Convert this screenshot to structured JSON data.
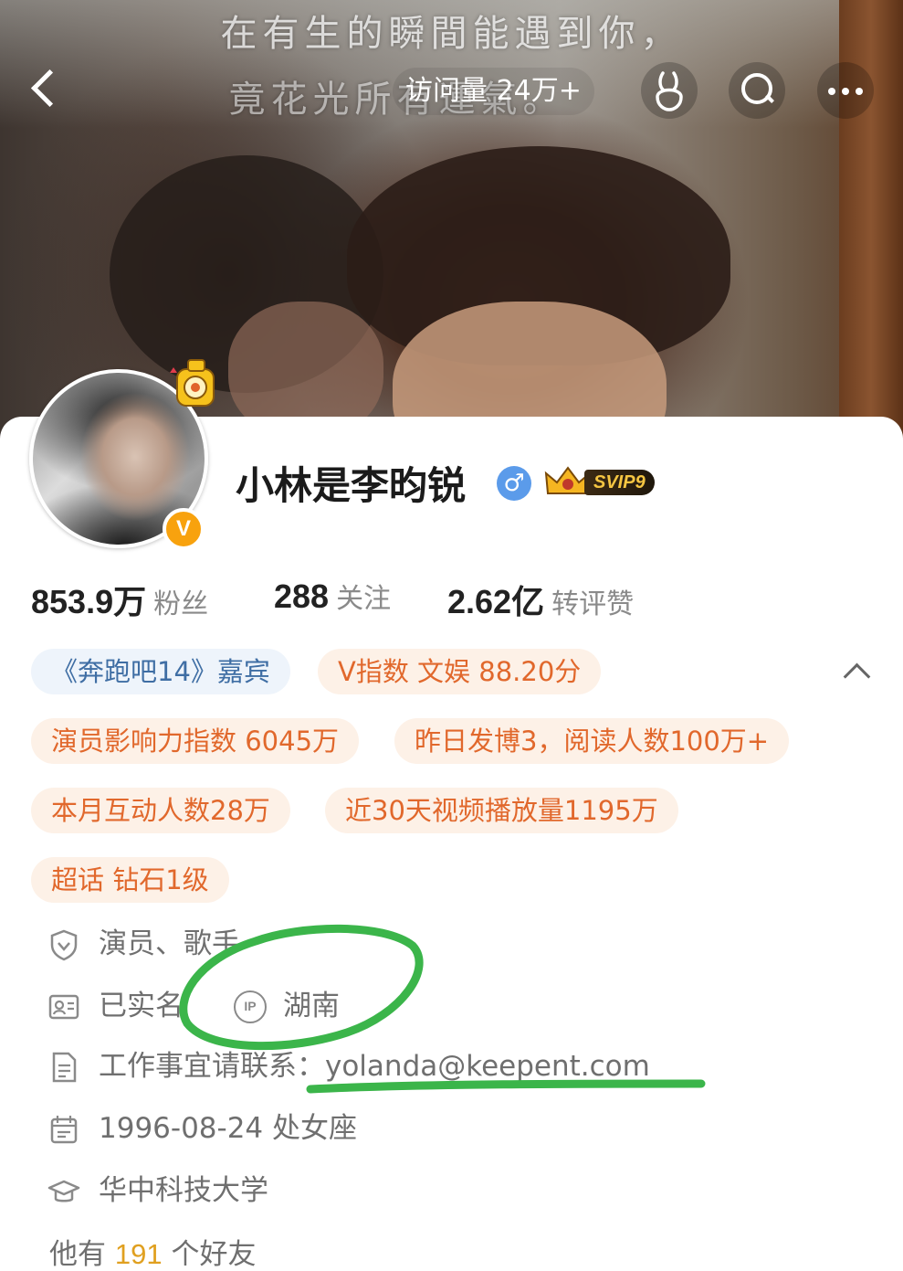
{
  "header": {
    "quote_line1": "在有生的瞬間能遇到你，",
    "quote_line2": "竟花光所有運氣。",
    "visits": "访问量 24万+",
    "back_icon": "chevron-left-icon",
    "rabbit_icon": "rabbit-gesture-icon",
    "search_icon": "search-icon",
    "more_icon": "more-dots-icon"
  },
  "profile": {
    "name": "小林是李昀锐",
    "gender_symbol": "♂",
    "svip_label": "SVIP9",
    "verified_badge": "V"
  },
  "stats": [
    {
      "value": "853.9万",
      "label": "粉丝"
    },
    {
      "value": "288",
      "label": "关注"
    },
    {
      "value": "2.62亿",
      "label": "转评赞"
    }
  ],
  "tags": [
    "《奔跑吧14》嘉宾",
    "V指数 文娱 88.20分",
    "演员影响力指数 6045万",
    "昨日发博3，阅读人数100万+",
    "本月互动人数28万",
    "近30天视频播放量1195万",
    "超话 钻石1级"
  ],
  "info": {
    "occupation": "演员、歌手",
    "verified": "已实名",
    "ip_badge": "IP",
    "ip_location": "湖南",
    "contact_prefix": "工作事宜请联系：",
    "contact_email": "yolanda@keepent.com",
    "birthday": "1996-08-24 处女座",
    "school": "华中科技大学"
  },
  "friends": {
    "prefix": "他有",
    "count": "191",
    "suffix": "个好友"
  },
  "colors": {
    "accent_orange": "#e1682c",
    "tag_bg_orange": "#fdf1e7",
    "tag_blue_text": "#3f6ea4",
    "annotation_green": "#3bb54a",
    "gender_blue": "#5b9bea",
    "vip_gold": "#f5c542"
  }
}
